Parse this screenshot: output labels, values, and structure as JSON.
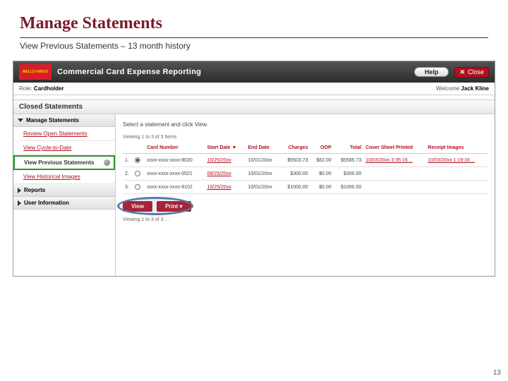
{
  "slide": {
    "title": "Manage Statements",
    "subtitle": "View Previous Statements – 13 month history",
    "page_number": "13"
  },
  "app": {
    "logo_text": "WELLS FARGO",
    "name": "Commercial Card Expense Reporting",
    "help": "Help",
    "close": "Close",
    "role_label": "Role:",
    "role_value": "Cardholder",
    "welcome_label": "Welcome",
    "welcome_user": "Jack Kline"
  },
  "section_title": "Closed Statements",
  "sidebar": {
    "head1": "Manage Statements",
    "items": [
      "Review Open Statements",
      "View Cycle-to-Date",
      "View Previous Statements",
      "View Historical Images"
    ],
    "head2": "Reports",
    "head3": "User Information"
  },
  "main": {
    "instruction": "Select a statement and click View.",
    "paging": "Viewing 1 to 3 of 3 Items",
    "headers": {
      "num": "",
      "sel": "",
      "card": "Card Number",
      "start": "Start Date",
      "end": "End Date",
      "charges": "Charges",
      "oop": "OOP",
      "total": "Total",
      "cover": "Cover Sheet Printed",
      "receipt": "Receipt Images"
    },
    "rows": [
      {
        "n": "1.",
        "sel": true,
        "card": "xxxx-xxxx-xxxx-8020",
        "start": "10/25/20xx",
        "end": "10/01/20xx",
        "charges": "$5503.73",
        "oop": "$82.00",
        "total": "$5585.73",
        "cover": "10/03/20xx 3:35:16…",
        "receipt": "10/03/20xx 1:19:16…"
      },
      {
        "n": "2.",
        "sel": false,
        "card": "xxxx-xxxx-xxxx-0521",
        "start": "08/25/20xx",
        "end": "10/01/20xx",
        "charges": "$300.00",
        "oop": "$0.00",
        "total": "$300.00",
        "cover": "",
        "receipt": ""
      },
      {
        "n": "3.",
        "sel": false,
        "card": "xxxx-xxxx-xxxx-8102",
        "start": "10/25/20xx",
        "end": "10/01/20xx",
        "charges": "$1000.00",
        "oop": "$0.00",
        "total": "$1000.00",
        "cover": "",
        "receipt": ""
      }
    ],
    "view_btn": "View",
    "print_btn": "Print",
    "paging2": "Viewing 1 to 3 of 3 …"
  }
}
